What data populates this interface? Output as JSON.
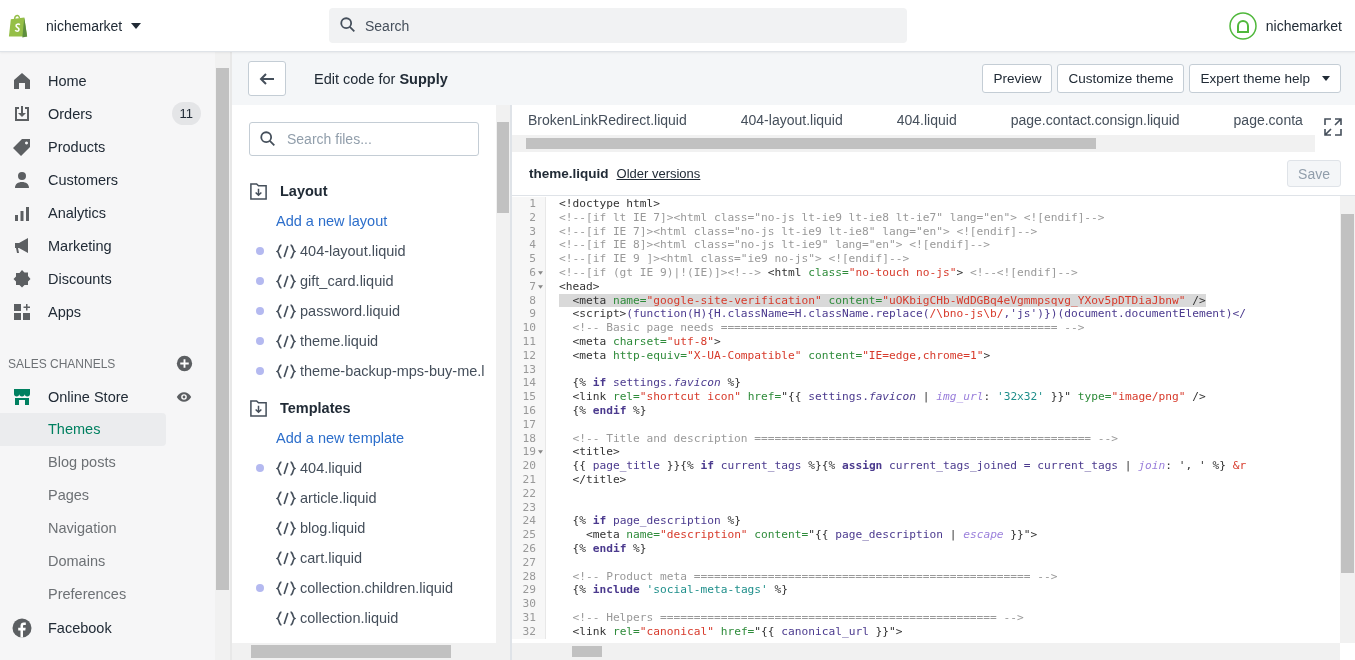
{
  "topbar": {
    "store_name": "nichemarket",
    "search": {
      "placeholder": "Search"
    },
    "user_name": "nichemarket"
  },
  "sidebar": {
    "items": [
      {
        "label": "Home"
      },
      {
        "label": "Orders",
        "badge": "11"
      },
      {
        "label": "Products"
      },
      {
        "label": "Customers"
      },
      {
        "label": "Analytics"
      },
      {
        "label": "Marketing"
      },
      {
        "label": "Discounts"
      },
      {
        "label": "Apps"
      }
    ],
    "sales_channels": {
      "heading": "SALES CHANNELS",
      "items": [
        {
          "label": "Online Store",
          "children": [
            {
              "label": "Themes",
              "selected": true
            },
            {
              "label": "Blog posts",
              "selected": false
            },
            {
              "label": "Pages",
              "selected": false
            },
            {
              "label": "Navigation",
              "selected": false
            },
            {
              "label": "Domains",
              "selected": false
            },
            {
              "label": "Preferences",
              "selected": false
            }
          ]
        },
        {
          "label": "Facebook"
        }
      ]
    }
  },
  "page_header": {
    "title": "Edit code for **Supply**",
    "buttons": [
      "Preview",
      "Customize theme",
      "Expert theme help"
    ]
  },
  "file_browser": {
    "search": {
      "placeholder": "Search files..."
    },
    "sections": [
      {
        "title": "Layout",
        "add_link": "Add a new layout",
        "files": [
          {
            "name": "404-layout.liquid",
            "dot": true
          },
          {
            "name": "gift_card.liquid",
            "dot": true
          },
          {
            "name": "password.liquid",
            "dot": true
          },
          {
            "name": "theme.liquid",
            "dot": true
          },
          {
            "name": "theme-backup-mps-buy-me.l",
            "dot": true
          }
        ]
      },
      {
        "title": "Templates",
        "add_link": "Add a new template",
        "files": [
          {
            "name": "404.liquid",
            "dot": true
          },
          {
            "name": "article.liquid",
            "dot": false
          },
          {
            "name": "blog.liquid",
            "dot": false
          },
          {
            "name": "cart.liquid",
            "dot": false
          },
          {
            "name": "collection.children.liquid",
            "dot": true
          },
          {
            "name": "collection.liquid",
            "dot": false
          }
        ]
      }
    ]
  },
  "editor": {
    "tabs": [
      {
        "label": "BrokenLinkRedirect.liquid",
        "selected": false
      },
      {
        "label": "404-layout.liquid",
        "selected": false
      },
      {
        "label": "404.liquid",
        "selected": false
      },
      {
        "label": "page.contact.consign.liquid",
        "selected": false
      },
      {
        "label": "page.conta",
        "selected": false
      }
    ],
    "file_name": "theme.liquid",
    "versions_link": "Older versions",
    "save_button": {
      "label": "Save",
      "disabled": true
    },
    "lines": [
      {
        "number": "1",
        "foldable": false,
        "tokens": [
          {
            "kind": "plain",
            "text": "<!doctype html>"
          }
        ]
      },
      {
        "number": "2",
        "foldable": false,
        "tokens": [
          {
            "kind": "comment",
            "text": "<!--[if lt IE 7]><html class=\"no-js lt-ie9 lt-ie8 lt-ie7\" lang=\"en\"> <![endif]-->"
          }
        ]
      },
      {
        "number": "3",
        "foldable": false,
        "tokens": [
          {
            "kind": "comment",
            "text": "<!--[if IE 7]><html class=\"no-js lt-ie9 lt-ie8\" lang=\"en\"> <![endif]-->"
          }
        ]
      },
      {
        "number": "4",
        "foldable": false,
        "tokens": [
          {
            "kind": "comment",
            "text": "<!--[if IE 8]><html class=\"no-js lt-ie9\" lang=\"en\"> <![endif]-->"
          }
        ]
      },
      {
        "number": "5",
        "foldable": false,
        "tokens": [
          {
            "kind": "comment",
            "text": "<!--[if IE 9 ]><html class=\"ie9 no-js\"> <![endif]-->"
          }
        ]
      },
      {
        "number": "6",
        "foldable": true,
        "tokens": [
          {
            "kind": "comment",
            "text": "<!--[if (gt IE 9)|!(IE)]><!-->"
          },
          {
            "kind": "plain",
            "text": " <html "
          },
          {
            "kind": "attribute",
            "text": "class="
          },
          {
            "kind": "string",
            "text": "\"no-touch no-js\""
          },
          {
            "kind": "plain",
            "text": ">"
          },
          {
            "kind": "comment",
            "text": " <!--<![endif]-->"
          }
        ]
      },
      {
        "number": "7",
        "foldable": true,
        "tokens": [
          {
            "kind": "plain",
            "text": "<head>"
          }
        ]
      },
      {
        "number": "8",
        "foldable": false,
        "highlighted": true,
        "tokens": [
          {
            "kind": "plain",
            "text": "  <meta "
          },
          {
            "kind": "attribute",
            "text": "name="
          },
          {
            "kind": "string",
            "text": "\"google-site-verification\""
          },
          {
            "kind": "attribute",
            "text": " content="
          },
          {
            "kind": "string",
            "text": "\"uOKbigCHb-WdDGBq4eVgmmpsqvg_YXov5pDTDiaJbnw\""
          },
          {
            "kind": "plain",
            "text": " />"
          }
        ]
      },
      {
        "number": "9",
        "foldable": false,
        "tokens": [
          {
            "kind": "plain",
            "text": "  <script>"
          },
          {
            "kind": "variable",
            "text": "(function(H){H.className=H.className.replace("
          },
          {
            "kind": "string",
            "text": "/\\bno-js\\b/"
          },
          {
            "kind": "variable",
            "text": ",'js')})(document.documentElement)</"
          }
        ]
      },
      {
        "number": "10",
        "foldable": false,
        "tokens": [
          {
            "kind": "comment",
            "text": "  <!-- Basic page needs ================================================== -->"
          }
        ]
      },
      {
        "number": "11",
        "foldable": false,
        "tokens": [
          {
            "kind": "plain",
            "text": "  <meta "
          },
          {
            "kind": "attribute",
            "text": "charset="
          },
          {
            "kind": "string",
            "text": "\"utf-8\""
          },
          {
            "kind": "plain",
            "text": ">"
          }
        ]
      },
      {
        "number": "12",
        "foldable": false,
        "tokens": [
          {
            "kind": "plain",
            "text": "  <meta "
          },
          {
            "kind": "attribute",
            "text": "http-equiv="
          },
          {
            "kind": "string",
            "text": "\"X-UA-Compatible\""
          },
          {
            "kind": "attribute",
            "text": " content="
          },
          {
            "kind": "string",
            "text": "\"IE=edge,chrome=1\""
          },
          {
            "kind": "plain",
            "text": ">"
          }
        ]
      },
      {
        "number": "13",
        "foldable": false
      },
      {
        "number": "14",
        "foldable": false,
        "tokens": [
          {
            "kind": "plain",
            "text": "  {% "
          },
          {
            "kind": "keyword",
            "text": "if"
          },
          {
            "kind": "variable",
            "text": " settings."
          },
          {
            "kind": "property",
            "text": "favicon"
          },
          {
            "kind": "plain",
            "text": " %}"
          }
        ]
      },
      {
        "number": "15",
        "foldable": false,
        "tokens": [
          {
            "kind": "plain",
            "text": "  <link "
          },
          {
            "kind": "attribute",
            "text": "rel="
          },
          {
            "kind": "string",
            "text": "\"shortcut icon\""
          },
          {
            "kind": "attribute",
            "text": " href="
          },
          {
            "kind": "plain",
            "text": "\"{{ "
          },
          {
            "kind": "variable",
            "text": "settings."
          },
          {
            "kind": "property",
            "text": "favicon"
          },
          {
            "kind": "plain",
            "text": " | "
          },
          {
            "kind": "filter",
            "text": "img_url"
          },
          {
            "kind": "plain",
            "text": ": "
          },
          {
            "kind": "literal",
            "text": "'32x32'"
          },
          {
            "kind": "plain",
            "text": " }}\""
          },
          {
            "kind": "attribute",
            "text": " type="
          },
          {
            "kind": "string",
            "text": "\"image/png\""
          },
          {
            "kind": "plain",
            "text": " />"
          }
        ]
      },
      {
        "number": "16",
        "foldable": false,
        "tokens": [
          {
            "kind": "plain",
            "text": "  {% "
          },
          {
            "kind": "keyword",
            "text": "endif"
          },
          {
            "kind": "plain",
            "text": " %}"
          }
        ]
      },
      {
        "number": "17",
        "foldable": false
      },
      {
        "number": "18",
        "foldable": false,
        "tokens": [
          {
            "kind": "comment",
            "text": "  <!-- Title and description ================================================== -->"
          }
        ]
      },
      {
        "number": "19",
        "foldable": true,
        "tokens": [
          {
            "kind": "plain",
            "text": "  <title>"
          }
        ]
      },
      {
        "number": "20",
        "foldable": false,
        "tokens": [
          {
            "kind": "plain",
            "text": "  {{ "
          },
          {
            "kind": "variable",
            "text": "page_title"
          },
          {
            "kind": "plain",
            "text": " }}{% "
          },
          {
            "kind": "keyword",
            "text": "if"
          },
          {
            "kind": "variable",
            "text": " current_tags"
          },
          {
            "kind": "plain",
            "text": " %}{% "
          },
          {
            "kind": "keyword",
            "text": "assign"
          },
          {
            "kind": "variable",
            "text": " current_tags_joined = current_tags"
          },
          {
            "kind": "plain",
            "text": " | "
          },
          {
            "kind": "filter",
            "text": "join"
          },
          {
            "kind": "plain",
            "text": ": ', ' %} "
          },
          {
            "kind": "string",
            "text": "&r"
          }
        ]
      },
      {
        "number": "21",
        "foldable": false,
        "tokens": [
          {
            "kind": "plain",
            "text": "  </title>"
          }
        ]
      },
      {
        "number": "22",
        "foldable": false
      },
      {
        "number": "23",
        "foldable": false
      },
      {
        "number": "24",
        "foldable": false,
        "tokens": [
          {
            "kind": "plain",
            "text": "  {% "
          },
          {
            "kind": "keyword",
            "text": "if"
          },
          {
            "kind": "variable",
            "text": " page_description"
          },
          {
            "kind": "plain",
            "text": " %}"
          }
        ]
      },
      {
        "number": "25",
        "foldable": false,
        "tokens": [
          {
            "kind": "plain",
            "text": "    <meta "
          },
          {
            "kind": "attribute",
            "text": "name="
          },
          {
            "kind": "string",
            "text": "\"description\""
          },
          {
            "kind": "attribute",
            "text": " content="
          },
          {
            "kind": "plain",
            "text": "\"{{ "
          },
          {
            "kind": "variable",
            "text": "page_description"
          },
          {
            "kind": "plain",
            "text": " | "
          },
          {
            "kind": "filter",
            "text": "escape"
          },
          {
            "kind": "plain",
            "text": " }}\">"
          }
        ]
      },
      {
        "number": "26",
        "foldable": false,
        "tokens": [
          {
            "kind": "plain",
            "text": "  {% "
          },
          {
            "kind": "keyword",
            "text": "endif"
          },
          {
            "kind": "plain",
            "text": " %}"
          }
        ]
      },
      {
        "number": "27",
        "foldable": false
      },
      {
        "number": "28",
        "foldable": false,
        "tokens": [
          {
            "kind": "comment",
            "text": "  <!-- Product meta ================================================== -->"
          }
        ]
      },
      {
        "number": "29",
        "foldable": false,
        "tokens": [
          {
            "kind": "plain",
            "text": "  {% "
          },
          {
            "kind": "keyword",
            "text": "include"
          },
          {
            "kind": "literal",
            "text": " 'social-meta-tags'"
          },
          {
            "kind": "plain",
            "text": " %}"
          }
        ]
      },
      {
        "number": "30",
        "foldable": false
      },
      {
        "number": "31",
        "foldable": false,
        "tokens": [
          {
            "kind": "comment",
            "text": "  <!-- Helpers ================================================== -->"
          }
        ]
      },
      {
        "number": "32",
        "foldable": false,
        "tokens": [
          {
            "kind": "plain",
            "text": "  <link "
          },
          {
            "kind": "attribute",
            "text": "rel="
          },
          {
            "kind": "string",
            "text": "\"canonical\""
          },
          {
            "kind": "attribute",
            "text": " href="
          },
          {
            "kind": "plain",
            "text": "\"{{ "
          },
          {
            "kind": "variable",
            "text": "canonical_url"
          },
          {
            "kind": "plain",
            "text": " }}\">"
          }
        ]
      }
    ]
  }
}
